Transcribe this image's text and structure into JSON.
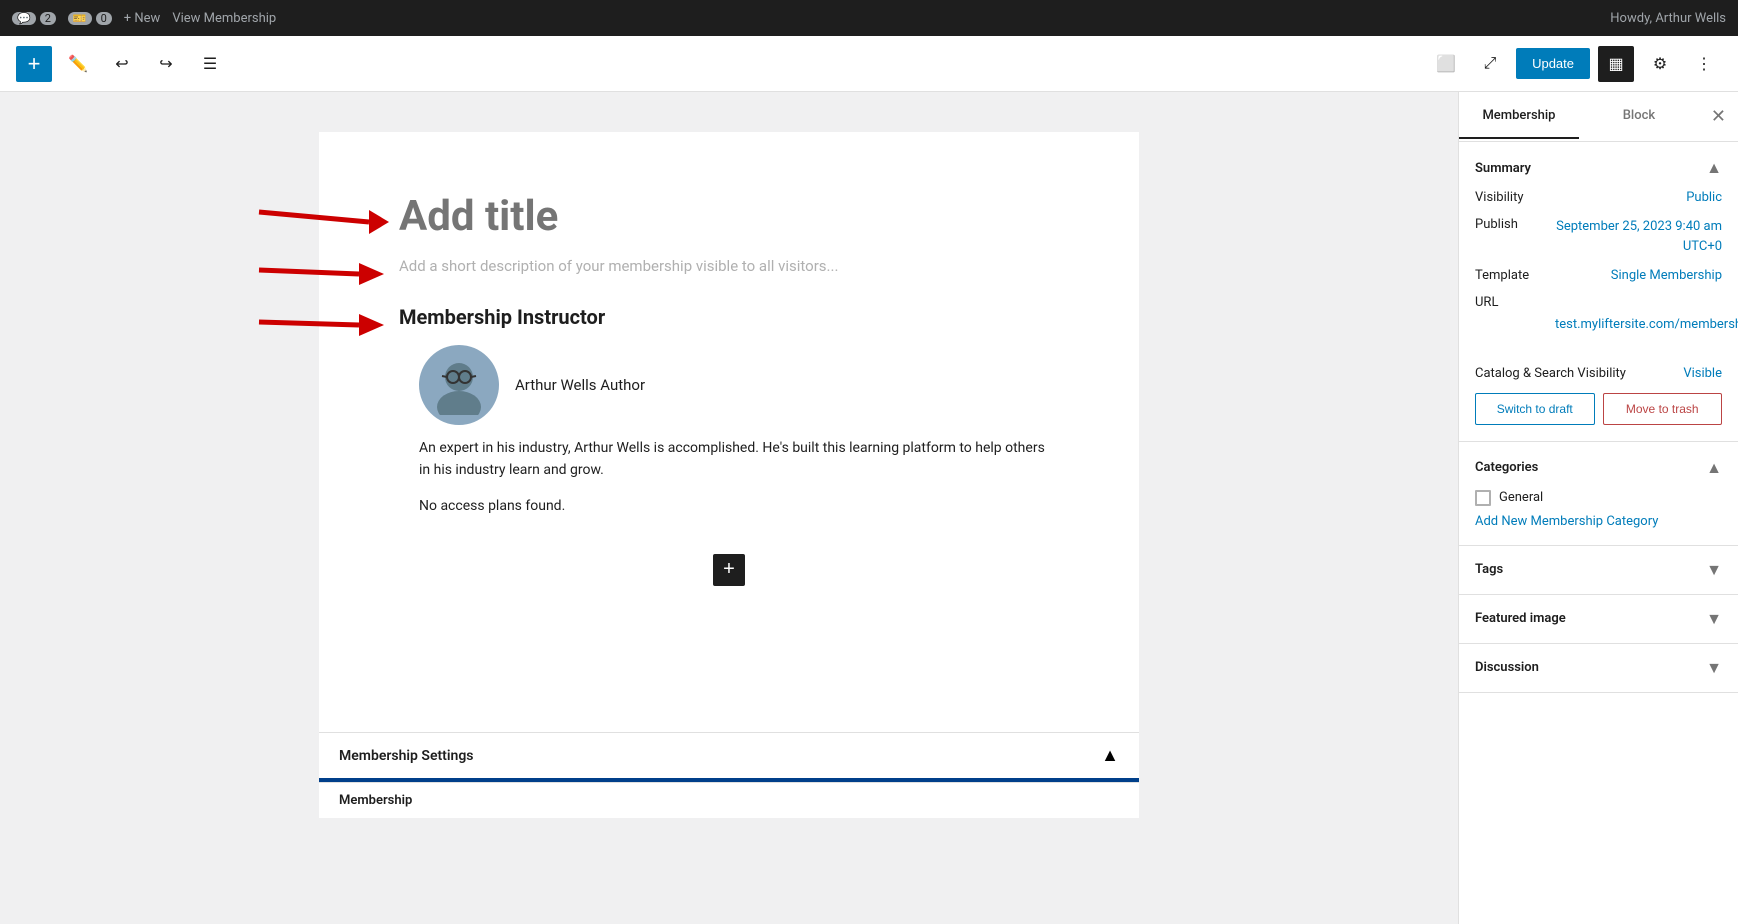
{
  "adminBar": {
    "comments_count": "2",
    "tickets_count": "0",
    "new_label": "+ New",
    "view_label": "View Membership",
    "user_greeting": "Howdy, Arthur Wells"
  },
  "toolbar": {
    "add_icon": "+",
    "update_label": "Update",
    "ellipsis_icon": "⋮"
  },
  "editor": {
    "title_placeholder": "Add title",
    "description_placeholder": "Add a short description of your membership visible to all visitors...",
    "instructor_heading": "Membership Instructor",
    "instructor_name": "Arthur Wells Author",
    "instructor_bio": "An expert in his industry, Arthur Wells is accomplished. He's built this learning platform to help others in his industry learn and grow.",
    "no_plans_text": "No access plans found."
  },
  "bottom_bar": {
    "title": "Membership Settings",
    "tab_label": "Membership"
  },
  "sidebar": {
    "tab_membership": "Membership",
    "tab_block": "Block",
    "summary_title": "Summary",
    "visibility_label": "Visibility",
    "visibility_value": "Public",
    "publish_label": "Publish",
    "publish_value": "September 25, 2023 9:40 am UTC+0",
    "template_label": "Template",
    "template_value": "Single Membership",
    "url_label": "URL",
    "url_value": "nadia-test.myliftersite.com/membership/course-bundle/",
    "catalog_label": "Catalog & Search Visibility",
    "catalog_value": "Visible",
    "switch_draft_label": "Switch to draft",
    "move_trash_label": "Move to trash",
    "categories_title": "Categories",
    "category_general": "General",
    "add_category_label": "Add New Membership Category",
    "tags_title": "Tags",
    "featured_image_title": "Featured image",
    "discussion_title": "Discussion"
  }
}
